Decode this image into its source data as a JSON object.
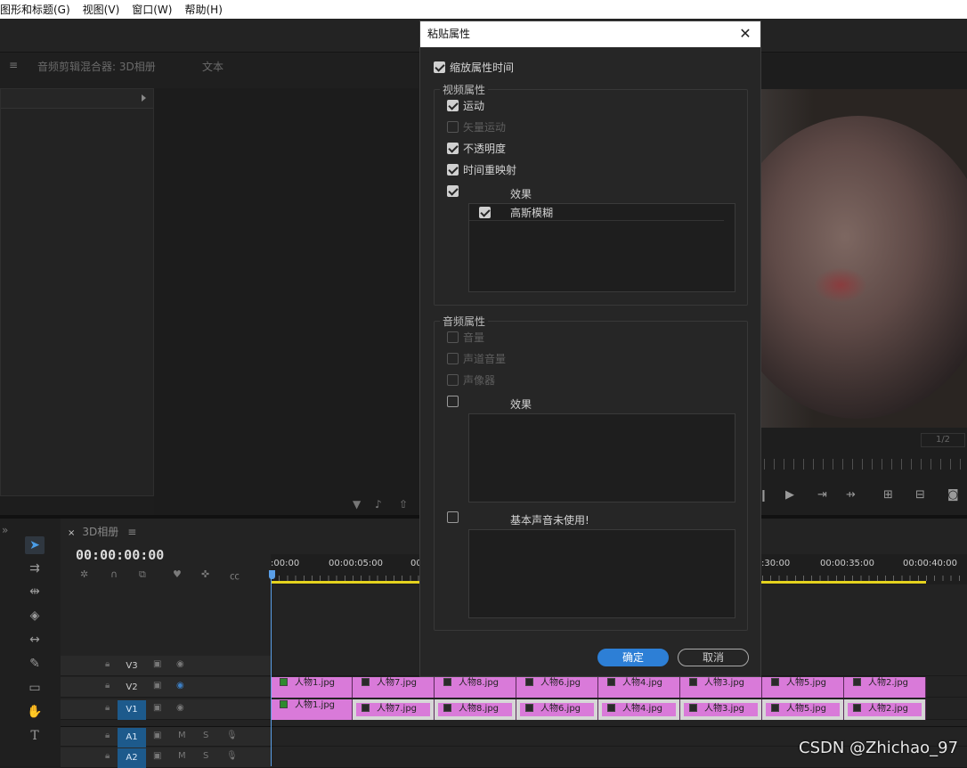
{
  "menubar": {
    "items": [
      "图形和标题(G)",
      "视图(V)",
      "窗口(W)",
      "帮助(H)"
    ]
  },
  "panel_tabs": [
    "音频剪辑混合器: 3D相册",
    "文本"
  ],
  "monitor": {
    "fraction": "1/2"
  },
  "timeline": {
    "sequence_tab": "3D相册",
    "timecode": "00:00:00:00",
    "ruler_labels": [
      ":00:00",
      "00:00:05:00",
      "00",
      ":30:00",
      "00:00:35:00",
      "00:00:40:00"
    ],
    "tracks": [
      {
        "name": "V3",
        "type": "video"
      },
      {
        "name": "V2",
        "type": "video"
      },
      {
        "name": "V1",
        "type": "video"
      },
      {
        "name": "A1",
        "type": "audio"
      },
      {
        "name": "A2",
        "type": "audio"
      }
    ],
    "audio_track_buttons": {
      "mute": "M",
      "solo": "S"
    },
    "v2_clips": [
      "人物1.jpg",
      "人物7.jpg",
      "人物8.jpg",
      "人物6.jpg",
      "人物4.jpg",
      "人物3.jpg",
      "人物5.jpg",
      "人物2.jpg"
    ],
    "v1_clips": [
      "人物1.jpg",
      "人物7.jpg",
      "人物8.jpg",
      "人物6.jpg",
      "人物4.jpg",
      "人物3.jpg",
      "人物5.jpg",
      "人物2.jpg"
    ]
  },
  "dialog": {
    "title": "粘贴属性",
    "scale_time": {
      "label": "缩放属性时间",
      "checked": true
    },
    "video_group": {
      "label": "视频属性",
      "items": [
        {
          "label": "运动",
          "checked": true,
          "enabled": true
        },
        {
          "label": "矢量运动",
          "checked": false,
          "enabled": false
        },
        {
          "label": "不透明度",
          "checked": true,
          "enabled": true
        },
        {
          "label": "时间重映射",
          "checked": true,
          "enabled": true
        }
      ],
      "effects_label": "效果",
      "effects_checked": true,
      "effects_list": [
        {
          "label": "高斯模糊",
          "checked": true
        }
      ]
    },
    "audio_group": {
      "label": "音频属性",
      "items": [
        {
          "label": "音量",
          "checked": false,
          "enabled": false
        },
        {
          "label": "声道音量",
          "checked": false,
          "enabled": false
        },
        {
          "label": "声像器",
          "checked": false,
          "enabled": false
        }
      ],
      "effects_label": "效果",
      "effects_checked": false,
      "essential_label": "基本声音未使用!",
      "essential_checked": false
    },
    "ok_label": "确定",
    "cancel_label": "取消"
  },
  "watermark": "CSDN @Zhichao_97"
}
